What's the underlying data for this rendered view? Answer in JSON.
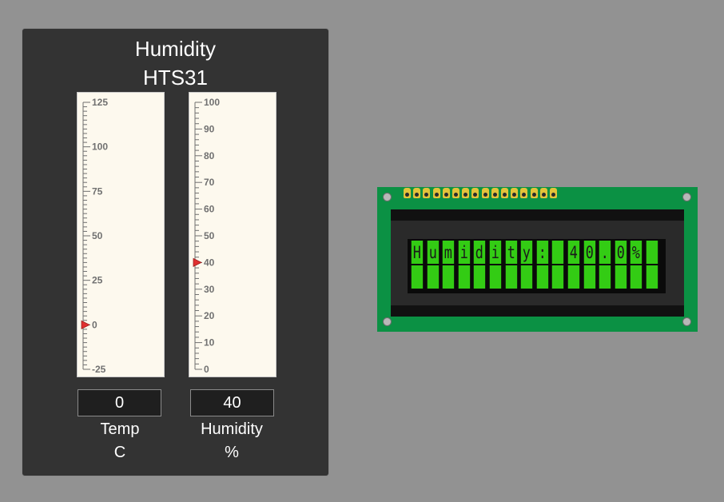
{
  "panel": {
    "title_line1": "Humidity",
    "title_line2": "HTS31"
  },
  "gauges": {
    "temperature": {
      "min": -25,
      "max": 125,
      "tick_labels": [
        "125",
        "100",
        "75",
        "50",
        "25",
        "0",
        "-25"
      ],
      "value": 0,
      "readout": "0",
      "caption_line1": "Temp",
      "caption_line2": "C"
    },
    "humidity": {
      "min": 0,
      "max": 100,
      "tick_labels": [
        "100",
        "90",
        "80",
        "70",
        "60",
        "50",
        "40",
        "30",
        "20",
        "10",
        "0"
      ],
      "value": 40,
      "readout": "40",
      "caption_line1": "Humidity",
      "caption_line2": "%"
    }
  },
  "lcd": {
    "line1": "Humidity: 40.0%",
    "line2": "",
    "columns": 16,
    "cell_color": "#33cc14",
    "board_color": "#0b9144",
    "pin_count": 16
  },
  "colors": {
    "background": "#929292",
    "panel": "#333333",
    "gauge_face": "#fdf9ee",
    "pointer": "#e03030"
  }
}
